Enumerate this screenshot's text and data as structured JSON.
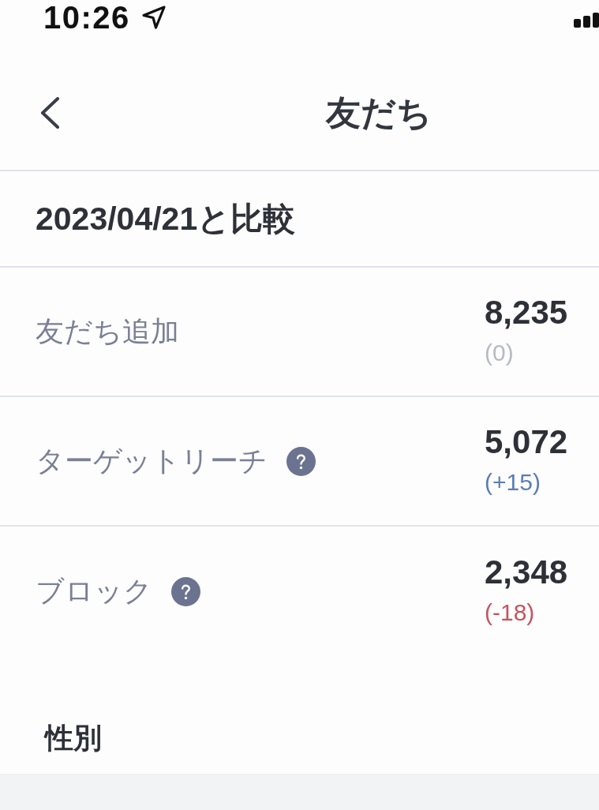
{
  "status_bar": {
    "time": "10:26"
  },
  "header": {
    "title": "友だち"
  },
  "comparison": {
    "heading": "2023/04/21と比較"
  },
  "stats": [
    {
      "label": "友だち追加",
      "help": false,
      "value": "8,235",
      "change": "(0)",
      "color": "#b7bac4"
    },
    {
      "label": "ターゲットリーチ",
      "help": true,
      "value": "5,072",
      "change": "(+15)",
      "color": "#5b7db7"
    },
    {
      "label": "ブロック",
      "help": true,
      "value": "2,348",
      "change": "(-18)",
      "color": "#c4565f"
    }
  ],
  "section": {
    "heading": "性別"
  }
}
